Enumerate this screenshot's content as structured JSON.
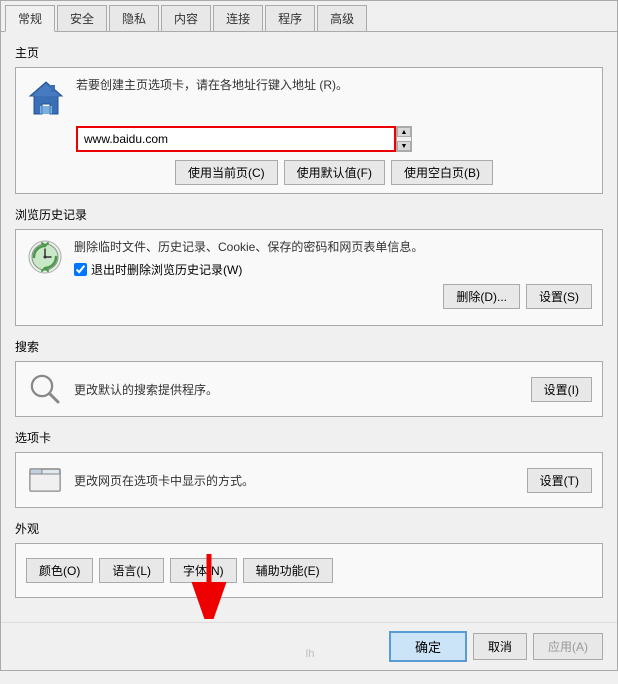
{
  "tabs": [
    {
      "label": "常规",
      "active": true
    },
    {
      "label": "安全",
      "active": false
    },
    {
      "label": "隐私",
      "active": false
    },
    {
      "label": "内容",
      "active": false
    },
    {
      "label": "连接",
      "active": false
    },
    {
      "label": "程序",
      "active": false
    },
    {
      "label": "高级",
      "active": false
    }
  ],
  "homepage": {
    "section_title": "主页",
    "description": "若要创建主页选项卡，请在各地址行键入地址 (R)。",
    "url_value": "www.baidu.com",
    "btn_current": "使用当前页(C)",
    "btn_default": "使用默认值(F)",
    "btn_blank": "使用空白页(B)"
  },
  "history": {
    "section_title": "浏览历史记录",
    "description": "删除临时文件、历史记录、Cookie、保存的密码和网页表单信息。",
    "checkbox_label": "退出时删除浏览历史记录(W)",
    "checkbox_checked": true,
    "btn_delete": "删除(D)...",
    "btn_settings": "设置(S)"
  },
  "search": {
    "section_title": "搜索",
    "description": "更改默认的搜索提供程序。",
    "btn_settings": "设置(I)"
  },
  "tabs_section": {
    "section_title": "选项卡",
    "description": "更改网页在选项卡中显示的方式。",
    "btn_settings": "设置(T)"
  },
  "appearance": {
    "section_title": "外观",
    "btn_color": "颜色(O)",
    "btn_language": "语言(L)",
    "btn_font": "字体(N)",
    "btn_accessibility": "辅助功能(E)"
  },
  "bottom": {
    "btn_confirm": "确定",
    "btn_cancel": "取消",
    "btn_apply": "应用(A)"
  },
  "watermark": "Ih"
}
